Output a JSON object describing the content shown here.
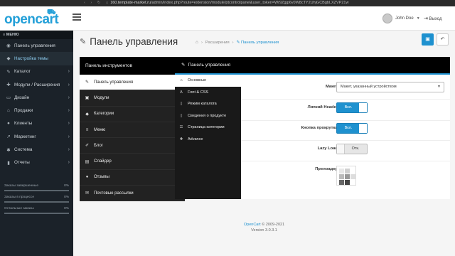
{
  "browser": {
    "host": "160.template-market.ru",
    "path": "/admin/index.php?route=extension/module/ptcontrolpanel&user_token=Wr9Zgjp6v0W8cTY2UhjGCBgbLXZVP21w"
  },
  "header": {
    "logo_text": "opencart",
    "user_name": "John Doe",
    "logout_label": "Выход"
  },
  "sidebar": {
    "menu_title": "МЕНЮ",
    "items": [
      {
        "label": "Панель управления",
        "icon": "dashboard-icon",
        "glyph": "◉",
        "arrow": false,
        "state": ""
      },
      {
        "label": "Настройка темы",
        "icon": "theme-settings-icon",
        "glyph": "◆",
        "arrow": false,
        "state": "sub"
      },
      {
        "label": "Каталог",
        "icon": "tag-icon",
        "glyph": "✎",
        "arrow": true,
        "state": ""
      },
      {
        "label": "Модули / Расширения",
        "icon": "puzzle-icon",
        "glyph": "✚",
        "arrow": true,
        "state": ""
      },
      {
        "label": "Дизайн",
        "icon": "monitor-icon",
        "glyph": "▭",
        "arrow": true,
        "state": ""
      },
      {
        "label": "Продажи",
        "icon": "cart-icon",
        "glyph": "⌂",
        "arrow": true,
        "state": ""
      },
      {
        "label": "Клиенты",
        "icon": "user-icon",
        "glyph": "●",
        "arrow": true,
        "state": ""
      },
      {
        "label": "Маркетинг",
        "icon": "share-icon",
        "glyph": "↗",
        "arrow": true,
        "state": ""
      },
      {
        "label": "Система",
        "icon": "cog-icon",
        "glyph": "✱",
        "arrow": true,
        "state": ""
      },
      {
        "label": "Отчеты",
        "icon": "bar-chart-icon",
        "glyph": "▮",
        "arrow": true,
        "state": ""
      }
    ],
    "stats": [
      {
        "label": "Заказы завершенные",
        "value": "0%",
        "fraction": 0
      },
      {
        "label": "Заказы в процессе",
        "value": "0%",
        "fraction": 0
      },
      {
        "label": "Остальные заказы",
        "value": "0%",
        "fraction": 0
      }
    ]
  },
  "page": {
    "title": "Панель управления",
    "breadcrumb": [
      "Расширения",
      "Панель управления"
    ],
    "save_tooltip_icon": "save-icon",
    "back_icon": "reply-icon"
  },
  "tools_panel": {
    "title": "Панель инструментов",
    "items": [
      {
        "label": "Панель управления",
        "icon": "magic-icon",
        "glyph": "✎",
        "active": true,
        "arrow": false
      },
      {
        "label": "Модули",
        "icon": "cube-icon",
        "glyph": "▣",
        "active": false,
        "arrow": false
      },
      {
        "label": "Категории",
        "icon": "tag-icon",
        "glyph": "◆",
        "active": false,
        "arrow": false
      },
      {
        "label": "Меню",
        "icon": "menu-icon",
        "glyph": "≡",
        "active": false,
        "arrow": false
      },
      {
        "label": "Блог",
        "icon": "pen-icon",
        "glyph": "✐",
        "active": false,
        "arrow": true
      },
      {
        "label": "Слайдер",
        "icon": "slider-icon",
        "glyph": "▤",
        "active": false,
        "arrow": false
      },
      {
        "label": "Отзывы",
        "icon": "comment-icon",
        "glyph": "●",
        "active": false,
        "arrow": false
      },
      {
        "label": "Почтовые рассылки",
        "icon": "envelope-icon",
        "glyph": "✉",
        "active": false,
        "arrow": false
      }
    ]
  },
  "settings_panel": {
    "title": "Панель управления",
    "tabs": [
      {
        "label": "Основные",
        "icon": "home-icon",
        "glyph": "⌂",
        "active": true
      },
      {
        "label": "Font & CSS",
        "icon": "font-icon",
        "glyph": "A",
        "active": false
      },
      {
        "label": "Режим каталога",
        "icon": "book-icon",
        "glyph": "▯",
        "active": false
      },
      {
        "label": "Сведения о продукте",
        "icon": "file-icon",
        "glyph": "▯",
        "active": false
      },
      {
        "label": "Страница категории",
        "icon": "list-icon",
        "glyph": "☰",
        "active": false
      },
      {
        "label": "Advance",
        "icon": "plus-circle-icon",
        "glyph": "✚",
        "active": false
      }
    ],
    "fields": {
      "layout": {
        "label": "Макет",
        "value": "Макет, указанный устройством"
      },
      "sticky_header": {
        "label": "Липкий Header",
        "value": "Вкл."
      },
      "scroll_button": {
        "label": "Кнопка прокрутки",
        "value": "Вкл."
      },
      "lazy_load": {
        "label": "Lazy Load",
        "value": "Отк."
      },
      "preloader": {
        "label": "Прелоадер"
      }
    }
  },
  "footer": {
    "brand": "OpenCart",
    "copyright": "© 2009-2021",
    "version": "Version 3.0.3.1"
  },
  "colors": {
    "accent": "#1e91cf",
    "sidebar_bg": "#1b2229",
    "panel_dark": "#000000"
  }
}
